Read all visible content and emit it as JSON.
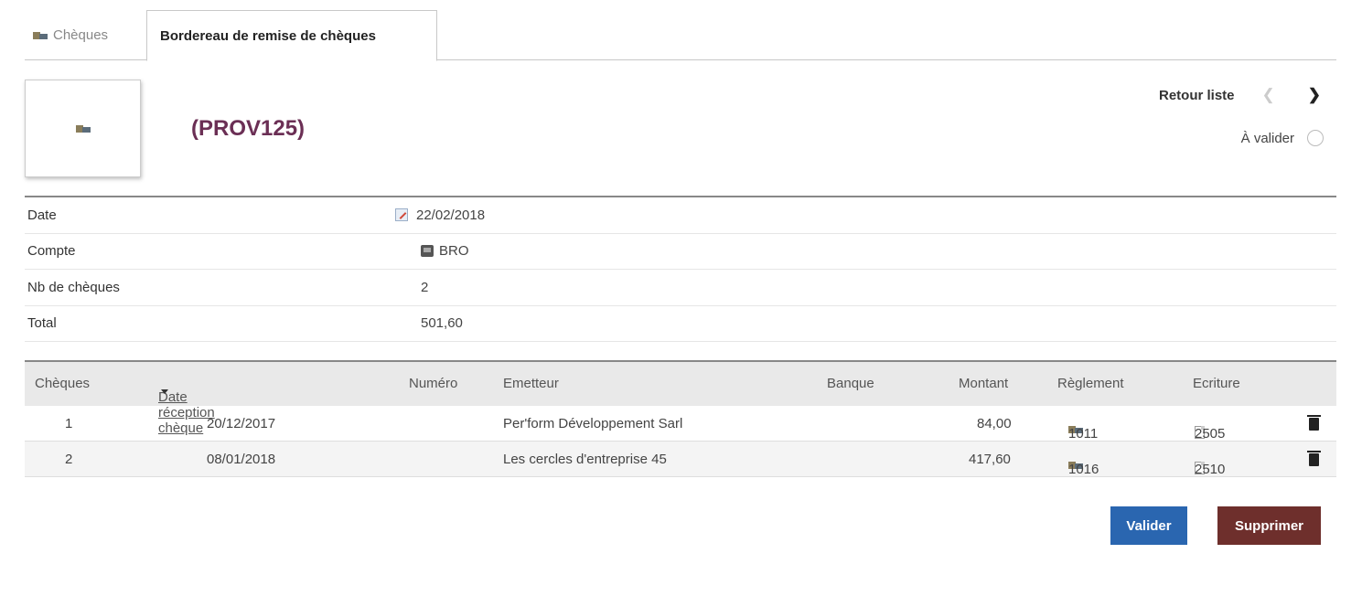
{
  "tabs": [
    {
      "label": "Chèques",
      "icon": "cheque-icon",
      "active": false
    },
    {
      "label": "Bordereau de remise de chèques",
      "active": true
    }
  ],
  "header": {
    "reference": "(PROV125)",
    "back_link": "Retour liste",
    "status_label": "À valider"
  },
  "info": [
    {
      "label": "Date",
      "value": "22/02/2018",
      "icon": "edit-icon"
    },
    {
      "label": "Compte",
      "value": "BRO",
      "icon": "bank-icon"
    },
    {
      "label": "Nb de chèques",
      "value": "2"
    },
    {
      "label": "Total",
      "value": "501,60"
    }
  ],
  "table": {
    "headers": {
      "cheques": "Chèques",
      "date": "Date réception chèque",
      "numero": "Numéro",
      "emetteur": "Emetteur",
      "banque": "Banque",
      "montant": "Montant",
      "reglement": "Règlement",
      "ecriture": "Ecriture"
    },
    "rows": [
      {
        "index": "1",
        "date": "20/12/2017",
        "numero": "",
        "emetteur": "Per'form Développement Sarl",
        "banque": "",
        "montant": "84,00",
        "reglement": "1011",
        "ecriture": "2505"
      },
      {
        "index": "2",
        "date": "08/01/2018",
        "numero": "",
        "emetteur": "Les cercles d'entreprise 45",
        "banque": "",
        "montant": "417,60",
        "reglement": "1016",
        "ecriture": "2510"
      }
    ]
  },
  "actions": {
    "valider": "Valider",
    "supprimer": "Supprimer"
  },
  "colors": {
    "title": "#6b2f55",
    "valider": "#2a66b0",
    "supprimer": "#6e2f2c"
  }
}
